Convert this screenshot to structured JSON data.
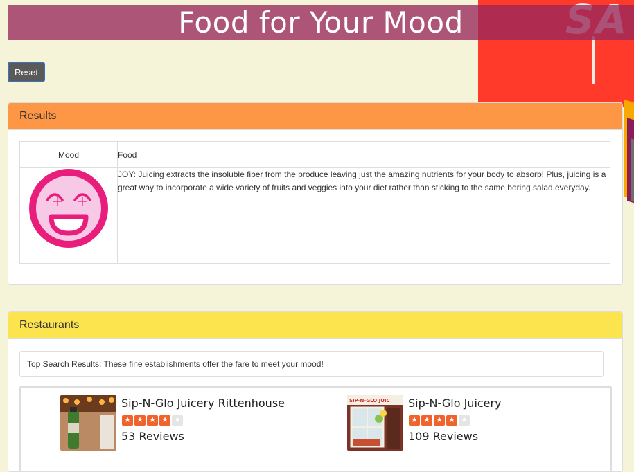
{
  "header": {
    "title": "Food for Your Mood"
  },
  "controls": {
    "reset_label": "Reset"
  },
  "background_art": {
    "text": "SA"
  },
  "results": {
    "heading": "Results",
    "columns": [
      "Mood",
      "Food"
    ],
    "mood_icon": "joy-face-icon",
    "food_text": "JOY: Juicing extracts the insoluble fiber from the produce leaving just the amazing nutrients for your body to absorb! Plus, juicing is a great way to incorporate a wide variety of fruits and veggies into your diet rather than sticking to the same boring salad everyday."
  },
  "restaurants": {
    "heading": "Restaurants",
    "intro": "Top Search Results: These fine establishments offer the fare to meet your mood!",
    "items": [
      {
        "name": "Sip-N-Glo Juicery Rittenhouse",
        "rating": 4,
        "max_rating": 5,
        "reviews": "53 Reviews",
        "thumb": "juice-bottle-photo"
      },
      {
        "name": "Sip-N-Glo Juicery",
        "rating": 4,
        "max_rating": 5,
        "reviews": "109 Reviews",
        "thumb": "storefront-photo",
        "thumb_sign": "SIP-N-GLO JUIC"
      }
    ]
  },
  "colors": {
    "title_bar": "#99285a",
    "results_heading": "#fd9645",
    "restaurants_heading": "#fce44e",
    "star": "#f1632c",
    "joy_face": "#e91e7c",
    "page_bg": "#f5f3d8"
  }
}
